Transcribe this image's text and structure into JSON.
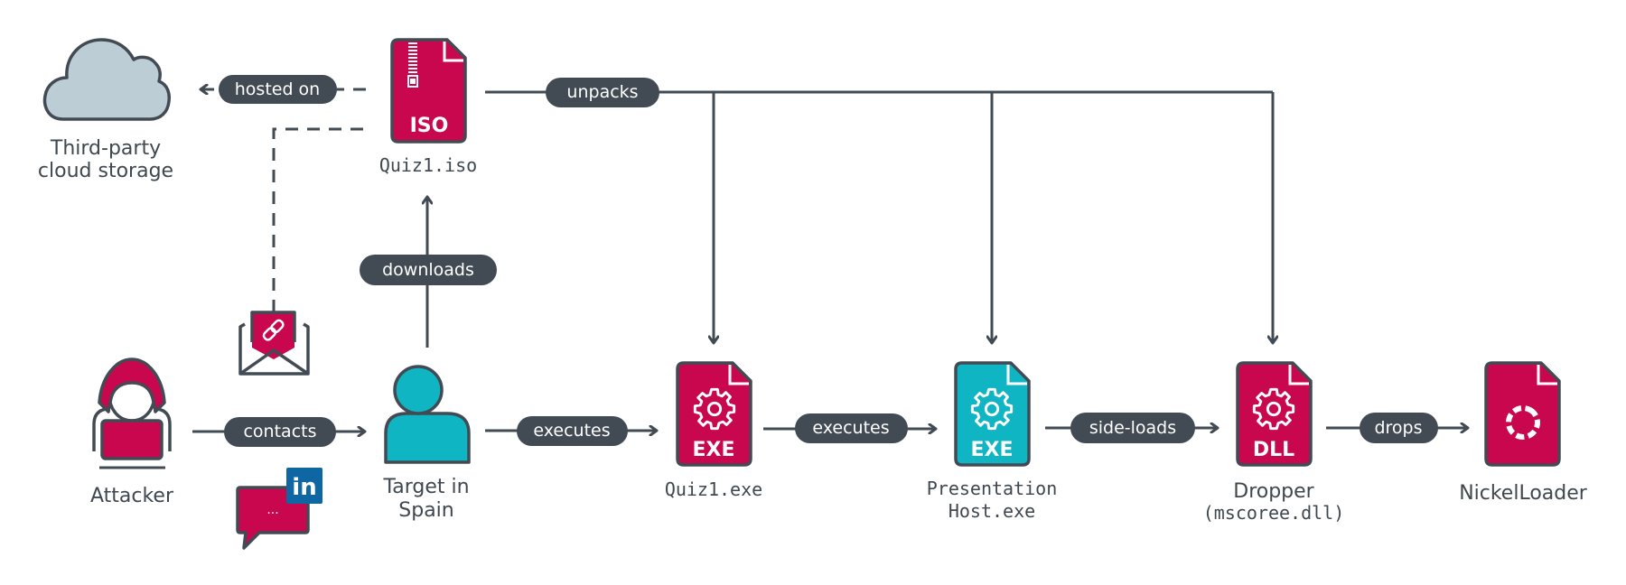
{
  "colors": {
    "crimson": "#c8074e",
    "teal": "#0fb5c3",
    "dark": "#424b54",
    "cloud": "#bccdd6",
    "linkedin": "#0e66a2"
  },
  "nodes": {
    "cloud": {
      "line1": "Third-party",
      "line2": "cloud storage",
      "icon": "cloud-icon"
    },
    "iso": {
      "badge": "ISO",
      "label": "Quiz1.iso",
      "icon": "iso-file-icon"
    },
    "attacker": {
      "label": "Attacker",
      "icon": "hooded-hacker-icon"
    },
    "target": {
      "line1": "Target in",
      "line2": "Spain",
      "icon": "person-icon"
    },
    "email": {
      "icon": "email-link-icon"
    },
    "linkedin": {
      "badge": "in",
      "dots": "...",
      "icon": "linkedin-message-icon"
    },
    "quiz_exe": {
      "badge": "EXE",
      "label": "Quiz1.exe",
      "icon": "exe-file-icon"
    },
    "pres_host": {
      "badge": "EXE",
      "line1": "Presentation",
      "line2": "Host.exe",
      "icon": "exe-file-icon"
    },
    "dropper": {
      "badge": "DLL",
      "line1": "Dropper",
      "line2": "(mscoree.dll)",
      "icon": "dll-file-icon"
    },
    "nickel": {
      "label": "NickelLoader",
      "icon": "loader-file-icon"
    }
  },
  "edges": {
    "hosted_on": "hosted on",
    "unpacks": "unpacks",
    "downloads": "downloads",
    "contacts": "contacts",
    "executes_1": "executes",
    "executes_2": "executes",
    "side_loads": "side-loads",
    "drops": "drops"
  }
}
